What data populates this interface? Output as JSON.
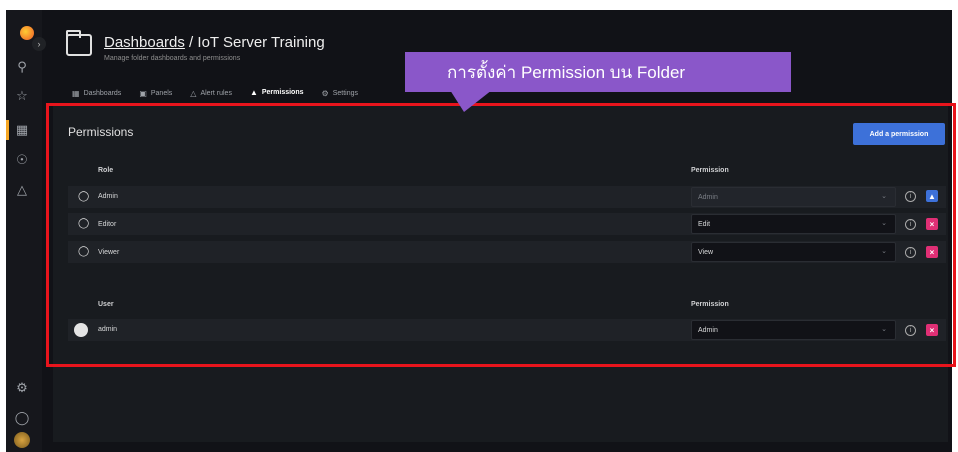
{
  "header": {
    "breadcrumb_link": "Dashboards",
    "breadcrumb_separator": " / ",
    "folder_name": "IoT Server Training",
    "subtitle": "Manage folder dashboards and permissions"
  },
  "tabs": [
    {
      "label": "Dashboards",
      "icon": "grid-icon",
      "active": false
    },
    {
      "label": "Panels",
      "icon": "panels-icon",
      "active": false
    },
    {
      "label": "Alert rules",
      "icon": "bell-icon",
      "active": false
    },
    {
      "label": "Permissions",
      "icon": "lock-icon",
      "active": true
    },
    {
      "label": "Settings",
      "icon": "gear-icon",
      "active": false
    }
  ],
  "callout": {
    "text": "การตั้งค่า Permission บน Folder"
  },
  "permissions": {
    "title": "Permissions",
    "add_button": "Add a permission",
    "role_header": "Role",
    "permission_header": "Permission",
    "roles": [
      {
        "name": "Admin",
        "permission": "Admin",
        "disabled": true,
        "action": "lock"
      },
      {
        "name": "Editor",
        "permission": "Edit",
        "disabled": false,
        "action": "remove"
      },
      {
        "name": "Viewer",
        "permission": "View",
        "disabled": false,
        "action": "remove"
      }
    ],
    "user_header": "User",
    "user_permission_header": "Permission",
    "users": [
      {
        "name": "admin",
        "permission": "Admin",
        "action": "remove"
      }
    ]
  },
  "colors": {
    "accent_tab": "#f05a28",
    "primary_button": "#3d71d9",
    "remove_button": "#e02f75",
    "callout": "#8a57c9",
    "highlight_border": "#e8141c"
  }
}
